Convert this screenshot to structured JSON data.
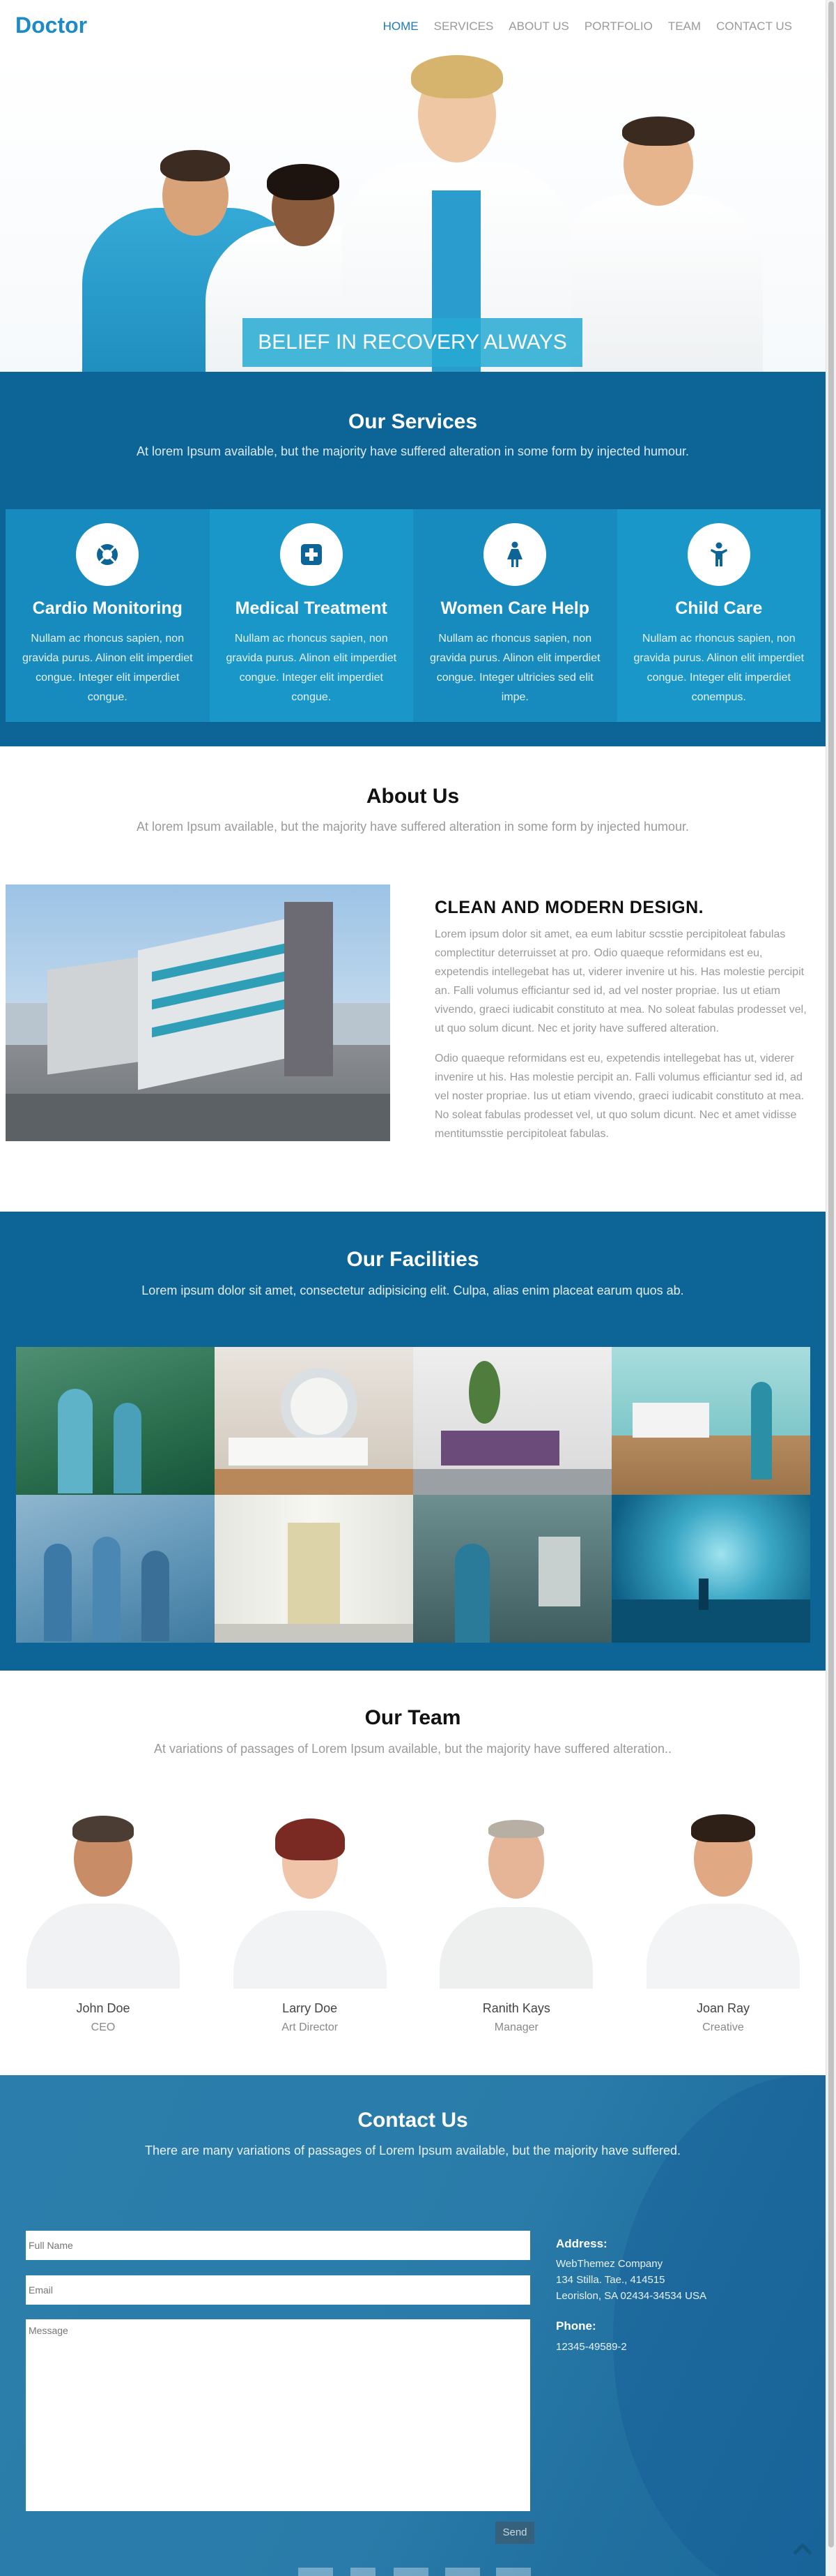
{
  "header": {
    "logo": "Doctor",
    "nav": [
      "HOME",
      "SERVICES",
      "ABOUT US",
      "PORTFOLIO",
      "TEAM",
      "CONTACT US"
    ],
    "active_nav": "HOME"
  },
  "hero": {
    "caption": "BELIEF IN RECOVERY ALWAYS"
  },
  "services": {
    "title": "Our Services",
    "subtitle": "At lorem Ipsum available, but the majority have suffered alteration in some form by injected humour.",
    "items": [
      {
        "icon": "lifebuoy-icon",
        "title": "Cardio Monitoring",
        "text": "Nullam ac rhoncus sapien, non gravida purus. Alinon elit imperdiet congue. Integer elit imperdiet congue."
      },
      {
        "icon": "medical-cross-icon",
        "title": "Medical Treatment",
        "text": "Nullam ac rhoncus sapien, non gravida purus. Alinon elit imperdiet congue. Integer elit imperdiet congue."
      },
      {
        "icon": "woman-icon",
        "title": "Women Care Help",
        "text": "Nullam ac rhoncus sapien, non gravida purus. Alinon elit imperdiet congue. Integer ultricies sed elit impe."
      },
      {
        "icon": "child-icon",
        "title": "Child Care",
        "text": "Nullam ac rhoncus sapien, non gravida purus. Alinon elit imperdiet congue. Integer elit imperdiet conempus."
      }
    ]
  },
  "about": {
    "title": "About Us",
    "subtitle": "At lorem Ipsum available, but the majority have suffered alteration in some form by injected humour.",
    "heading": "CLEAN AND MODERN DESIGN.",
    "paragraph1": "Lorem ipsum dolor sit amet, ea eum labitur scsstie percipitoleat fabulas complectitur deterruisset at pro. Odio quaeque reformidans est eu, expetendis intellegebat has ut, viderer invenire ut his. Has molestie percipit an. Falli volumus efficiantur sed id, ad vel noster propriae. Ius ut etiam vivendo, graeci iudicabit constituto at mea. No soleat fabulas prodesset vel, ut quo solum dicunt. Nec et jority have suffered alteration.",
    "paragraph2": "Odio quaeque reformidans est eu, expetendis intellegebat has ut, viderer invenire ut his. Has molestie percipit an. Falli volumus efficiantur sed id, ad vel noster propriae. Ius ut etiam vivendo, graeci iudicabit constituto at mea. No soleat fabulas prodesset vel, ut quo solum dicunt. Nec et amet vidisse mentitumsstie percipitoleat fabulas."
  },
  "facilities": {
    "title": "Our Facilities",
    "subtitle": "Lorem ipsum dolor sit amet, consectetur adipisicing elit. Culpa, alias enim placeat earum quos ab."
  },
  "team": {
    "title": "Our Team",
    "subtitle": "At variations of passages of Lorem Ipsum available, but the majority have suffered alteration..",
    "members": [
      {
        "name": "John Doe",
        "role": "CEO"
      },
      {
        "name": "Larry Doe",
        "role": "Art Director"
      },
      {
        "name": "Ranith Kays",
        "role": "Manager"
      },
      {
        "name": "Joan Ray",
        "role": "Creative"
      }
    ]
  },
  "contact": {
    "title": "Contact Us",
    "subtitle": "There are many variations of passages of Lorem Ipsum available, but the majority have suffered.",
    "full_name_placeholder": "Full Name",
    "email_placeholder": "Email",
    "message_placeholder": "Message",
    "send_label": "Send",
    "address_label": "Address:",
    "address_lines": [
      "WebThemez Company",
      "134 Stilla. Tae., 414515",
      "Leorislon, SA 02434-34534 USA"
    ],
    "phone_label": "Phone:",
    "phone": "12345-49589-2"
  },
  "colors": {
    "brand_blue": "#1d8bc9",
    "section_blue": "#0c6596",
    "card_blue": "#178bbd",
    "hero_caption": "#26aad2"
  }
}
